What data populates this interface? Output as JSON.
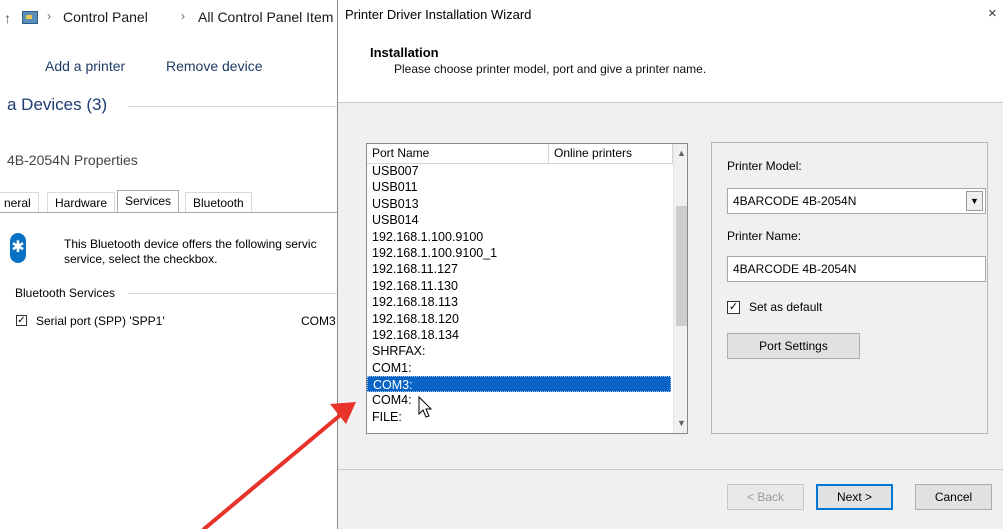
{
  "background_window": {
    "breadcrumb": [
      "Control Panel",
      "All Control Panel Item"
    ],
    "breadcrumb_sep": "›",
    "nav_arrow": "↑",
    "toolbar": {
      "add_printer": "Add a printer",
      "remove_device": "Remove device"
    },
    "devices_heading": "a Devices (3)",
    "properties_title": "4B-2054N Properties",
    "tabs": [
      "neral",
      "Hardware",
      "Services",
      "Bluetooth"
    ],
    "active_tab": "Services",
    "bluetooth_text_line1": "This Bluetooth device offers the following servic",
    "bluetooth_text_line2": "service, select the checkbox.",
    "bluetooth_services_label": "Bluetooth Services",
    "service": {
      "label": "Serial port (SPP) 'SPP1'",
      "port": "COM3",
      "checked": true
    }
  },
  "wizard": {
    "title": "Printer Driver Installation Wizard",
    "close_glyph": "×",
    "header_title": "Installation",
    "header_subtitle": "Please choose printer model, port and give a printer name.",
    "list": {
      "columns": [
        "Port Name",
        "Online printers"
      ],
      "rows": [
        "USB007",
        "USB011",
        "USB013",
        "USB014",
        "192.168.1.100.9100",
        "192.168.1.100.9100_1",
        "192.168.11.127",
        "192.168.11.130",
        "192.168.18.113",
        "192.168.18.120",
        "192.168.18.134",
        "SHRFAX:",
        "COM1:",
        "COM3:",
        "COM4:",
        "FILE:"
      ],
      "selected": "COM3:"
    },
    "printer_model_label": "Printer Model:",
    "printer_model_value": "4BARCODE 4B-2054N",
    "printer_name_label": "Printer Name:",
    "printer_name_value": "4BARCODE 4B-2054N",
    "set_default_label": "Set as default",
    "set_default_checked": true,
    "port_settings_button": "Port Settings",
    "back_button": "< Back",
    "next_button": "Next >",
    "cancel_button": "Cancel"
  },
  "colors": {
    "selection": "#0a64c8",
    "annotation_arrow": "#e8332a",
    "link": "#1f3c66"
  }
}
